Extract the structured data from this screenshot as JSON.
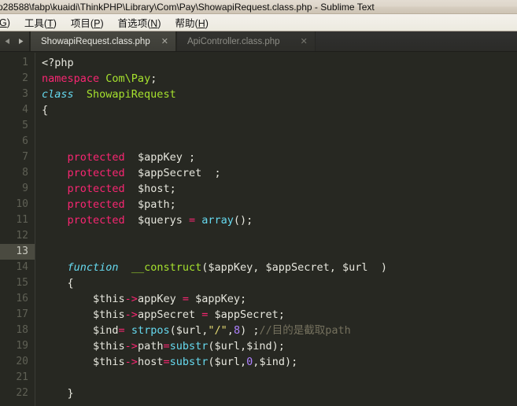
{
  "window": {
    "title": "p28588\\fabp\\kuaidi\\ThinkPHP\\Library\\Com\\Pay\\ShowapiRequest.class.php - Sublime Text",
    "app_name": "Sublime Text"
  },
  "menubar": {
    "items": [
      {
        "label": "G)",
        "mnemonic": "",
        "truncated": true
      },
      {
        "label": "工具",
        "mnemonic": "T"
      },
      {
        "label": "项目",
        "mnemonic": "P"
      },
      {
        "label": "首选项",
        "mnemonic": "N"
      },
      {
        "label": "帮助",
        "mnemonic": "H"
      }
    ]
  },
  "tabbar": {
    "nav_prev_icon": "triangle-left-icon",
    "nav_next_icon": "triangle-right-icon",
    "close_glyph": "✕",
    "tabs": [
      {
        "label": "ShowapiRequest.class.php",
        "active": true
      },
      {
        "label": "ApiController.class.php",
        "active": false
      }
    ]
  },
  "editor": {
    "active_line": 13,
    "first_line": 1,
    "theme_colors": {
      "background": "#272822",
      "foreground": "#e6e6dd",
      "gutter_text": "#5f6055",
      "gutter_active_bg": "#4a4a40",
      "keyword": "#f92672",
      "storage": "#66d9ef",
      "entity_name": "#a6e22e",
      "function_call": "#66d9ef",
      "string": "#e6db74",
      "number": "#ae81ff",
      "comment": "#75715e",
      "operator": "#f92672"
    },
    "line_numbers": [
      1,
      2,
      3,
      4,
      5,
      6,
      7,
      8,
      9,
      10,
      11,
      12,
      13,
      14,
      15,
      16,
      17,
      18,
      19,
      20,
      21,
      22
    ],
    "lines": [
      {
        "n": 1,
        "tokens": [
          {
            "t": "<?php",
            "c": "t-punc"
          }
        ]
      },
      {
        "n": 2,
        "tokens": [
          {
            "t": "namespace",
            "c": "t-kw"
          },
          {
            "t": " ",
            "c": "t-punc"
          },
          {
            "t": "Com\\Pay",
            "c": "t-name"
          },
          {
            "t": ";",
            "c": "t-punc"
          }
        ]
      },
      {
        "n": 3,
        "tokens": [
          {
            "t": "class",
            "c": "t-stor"
          },
          {
            "t": "  ",
            "c": "t-punc"
          },
          {
            "t": "ShowapiRequest",
            "c": "t-name"
          }
        ]
      },
      {
        "n": 4,
        "tokens": [
          {
            "t": "{",
            "c": "t-punc"
          }
        ]
      },
      {
        "n": 5,
        "tokens": []
      },
      {
        "n": 6,
        "tokens": []
      },
      {
        "n": 7,
        "tokens": [
          {
            "t": "    ",
            "c": "t-punc"
          },
          {
            "t": "protected",
            "c": "t-kw"
          },
          {
            "t": "  ",
            "c": "t-punc"
          },
          {
            "t": "$appKey ;",
            "c": "t-var"
          }
        ]
      },
      {
        "n": 8,
        "tokens": [
          {
            "t": "    ",
            "c": "t-punc"
          },
          {
            "t": "protected",
            "c": "t-kw"
          },
          {
            "t": "  ",
            "c": "t-punc"
          },
          {
            "t": "$appSecret  ;",
            "c": "t-var"
          }
        ]
      },
      {
        "n": 9,
        "tokens": [
          {
            "t": "    ",
            "c": "t-punc"
          },
          {
            "t": "protected",
            "c": "t-kw"
          },
          {
            "t": "  ",
            "c": "t-punc"
          },
          {
            "t": "$host;",
            "c": "t-var"
          }
        ]
      },
      {
        "n": 10,
        "tokens": [
          {
            "t": "    ",
            "c": "t-punc"
          },
          {
            "t": "protected",
            "c": "t-kw"
          },
          {
            "t": "  ",
            "c": "t-punc"
          },
          {
            "t": "$path;",
            "c": "t-var"
          }
        ]
      },
      {
        "n": 11,
        "tokens": [
          {
            "t": "    ",
            "c": "t-punc"
          },
          {
            "t": "protected",
            "c": "t-kw"
          },
          {
            "t": "  ",
            "c": "t-punc"
          },
          {
            "t": "$querys ",
            "c": "t-var"
          },
          {
            "t": "=",
            "c": "t-op"
          },
          {
            "t": " ",
            "c": "t-punc"
          },
          {
            "t": "array",
            "c": "t-fn"
          },
          {
            "t": "();",
            "c": "t-punc"
          }
        ]
      },
      {
        "n": 12,
        "tokens": []
      },
      {
        "n": 13,
        "tokens": []
      },
      {
        "n": 14,
        "tokens": [
          {
            "t": "    ",
            "c": "t-punc"
          },
          {
            "t": "function",
            "c": "t-stor"
          },
          {
            "t": "  ",
            "c": "t-punc"
          },
          {
            "t": "__construct",
            "c": "t-name"
          },
          {
            "t": "(",
            "c": "t-punc"
          },
          {
            "t": "$appKey, $appSecret, $url",
            "c": "t-var"
          },
          {
            "t": "  )",
            "c": "t-punc"
          }
        ]
      },
      {
        "n": 15,
        "tokens": [
          {
            "t": "    {",
            "c": "t-punc"
          }
        ]
      },
      {
        "n": 16,
        "tokens": [
          {
            "t": "        ",
            "c": "t-punc"
          },
          {
            "t": "$this",
            "c": "t-var"
          },
          {
            "t": "->",
            "c": "t-op"
          },
          {
            "t": "appKey ",
            "c": "t-var"
          },
          {
            "t": "=",
            "c": "t-op"
          },
          {
            "t": " ",
            "c": "t-punc"
          },
          {
            "t": "$appKey;",
            "c": "t-var"
          }
        ]
      },
      {
        "n": 17,
        "tokens": [
          {
            "t": "        ",
            "c": "t-punc"
          },
          {
            "t": "$this",
            "c": "t-var"
          },
          {
            "t": "->",
            "c": "t-op"
          },
          {
            "t": "appSecret ",
            "c": "t-var"
          },
          {
            "t": "=",
            "c": "t-op"
          },
          {
            "t": " ",
            "c": "t-punc"
          },
          {
            "t": "$appSecret;",
            "c": "t-var"
          }
        ]
      },
      {
        "n": 18,
        "tokens": [
          {
            "t": "        ",
            "c": "t-punc"
          },
          {
            "t": "$ind",
            "c": "t-var"
          },
          {
            "t": "=",
            "c": "t-op"
          },
          {
            "t": " ",
            "c": "t-punc"
          },
          {
            "t": "strpos",
            "c": "t-fn"
          },
          {
            "t": "(",
            "c": "t-punc"
          },
          {
            "t": "$url",
            "c": "t-var"
          },
          {
            "t": ",",
            "c": "t-punc"
          },
          {
            "t": "\"/\"",
            "c": "t-str"
          },
          {
            "t": ",",
            "c": "t-punc"
          },
          {
            "t": "8",
            "c": "t-num"
          },
          {
            "t": ") ;",
            "c": "t-punc"
          },
          {
            "t": "//目的是截取path",
            "c": "t-com"
          }
        ]
      },
      {
        "n": 19,
        "tokens": [
          {
            "t": "        ",
            "c": "t-punc"
          },
          {
            "t": "$this",
            "c": "t-var"
          },
          {
            "t": "->",
            "c": "t-op"
          },
          {
            "t": "path",
            "c": "t-var"
          },
          {
            "t": "=",
            "c": "t-op"
          },
          {
            "t": "substr",
            "c": "t-fn"
          },
          {
            "t": "(",
            "c": "t-punc"
          },
          {
            "t": "$url,$ind",
            "c": "t-var"
          },
          {
            "t": ");",
            "c": "t-punc"
          }
        ]
      },
      {
        "n": 20,
        "tokens": [
          {
            "t": "        ",
            "c": "t-punc"
          },
          {
            "t": "$this",
            "c": "t-var"
          },
          {
            "t": "->",
            "c": "t-op"
          },
          {
            "t": "host",
            "c": "t-var"
          },
          {
            "t": "=",
            "c": "t-op"
          },
          {
            "t": "substr",
            "c": "t-fn"
          },
          {
            "t": "(",
            "c": "t-punc"
          },
          {
            "t": "$url,",
            "c": "t-var"
          },
          {
            "t": "0",
            "c": "t-num"
          },
          {
            "t": ",",
            "c": "t-punc"
          },
          {
            "t": "$ind",
            "c": "t-var"
          },
          {
            "t": ");",
            "c": "t-punc"
          }
        ]
      },
      {
        "n": 21,
        "tokens": []
      },
      {
        "n": 22,
        "tokens": [
          {
            "t": "    }",
            "c": "t-punc"
          }
        ]
      }
    ]
  }
}
